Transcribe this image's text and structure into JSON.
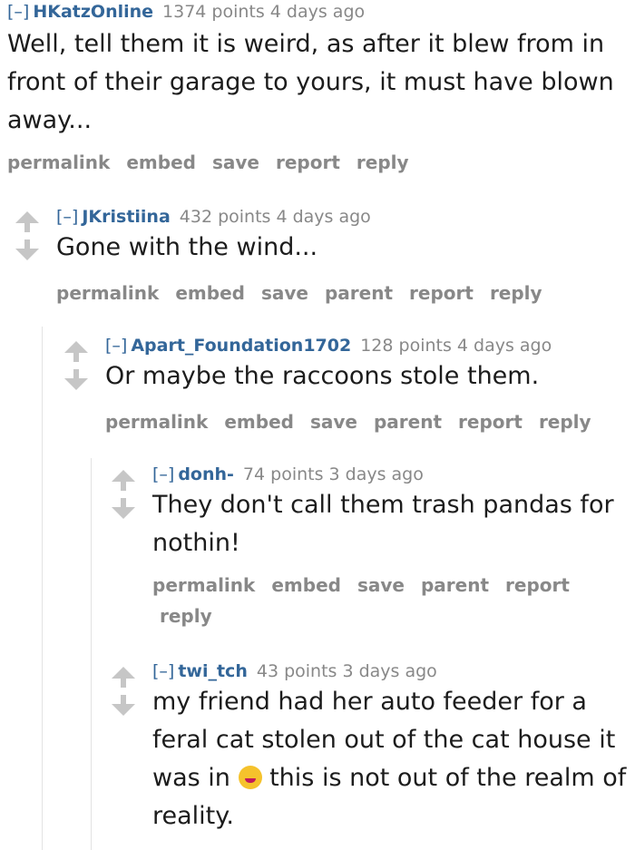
{
  "comments": [
    {
      "toggle": "[–]",
      "author": "HKatzOnline",
      "points": "1374 points",
      "time": "4 days ago",
      "body": "Well, tell them it is weird, as after it blew from in front of their garage to yours, it must have blown away...",
      "buttons": [
        "permalink",
        "embed",
        "save",
        "report",
        "reply"
      ]
    },
    {
      "toggle": "[–]",
      "author": "JKristiina",
      "points": "432 points",
      "time": "4 days ago",
      "body": "Gone with the wind...",
      "buttons": [
        "permalink",
        "embed",
        "save",
        "parent",
        "report",
        "reply"
      ]
    },
    {
      "toggle": "[–]",
      "author": "Apart_Foundation1702",
      "points": "128 points",
      "time": "4 days ago",
      "body": "Or maybe the raccoons stole them.",
      "buttons": [
        "permalink",
        "embed",
        "save",
        "parent",
        "report",
        "reply"
      ]
    },
    {
      "toggle": "[–]",
      "author": "donh-",
      "points": "74 points",
      "time": "3 days ago",
      "body": "They don't call them trash pandas for nothin!",
      "buttons": [
        "permalink",
        "embed",
        "save",
        "parent",
        "report",
        "reply"
      ]
    },
    {
      "toggle": "[–]",
      "author": "twi_tch",
      "points": "43 points",
      "time": "3 days ago",
      "body_part1": "my friend had her auto feeder for a feral cat stolen out of the cat house it was in",
      "emoji": "rolling-on-floor-laughing-emoji",
      "body_part2": "this is not out of the realm of reality."
    }
  ],
  "colors": {
    "author": "#336699",
    "meta": "#888888",
    "arrow": "#c6c6c6",
    "body": "#1c1c1c"
  }
}
